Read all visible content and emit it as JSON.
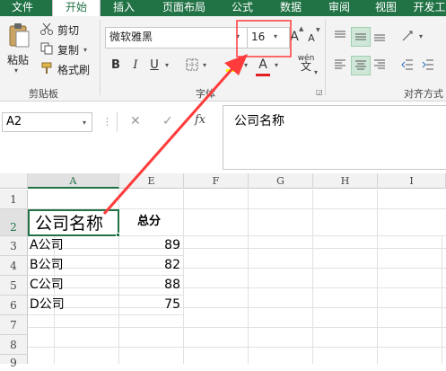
{
  "tabs": [
    "文件",
    "开始",
    "插入",
    "页面布局",
    "公式",
    "数据",
    "审阅",
    "视图",
    "开发工"
  ],
  "clipboard": {
    "paste": "粘贴",
    "cut": "剪切",
    "copy": "复制",
    "format_painter": "格式刷",
    "group": "剪贴板"
  },
  "font": {
    "name": "微软雅黑",
    "size": "16",
    "bold": "B",
    "italic": "I",
    "underline": "U",
    "grow": "A",
    "shrink": "A",
    "color": "A",
    "wen": "wén",
    "group": "字体"
  },
  "align": {
    "group": "对齐方式"
  },
  "namebox": {
    "value": "A2"
  },
  "formula": {
    "fx": "fx",
    "value": "公司名称"
  },
  "columns": [
    "A",
    "E",
    "F",
    "G",
    "H",
    "I"
  ],
  "rows": [
    "1",
    "2",
    "3",
    "4",
    "5",
    "6",
    "7",
    "8",
    "9"
  ],
  "sheet": {
    "header": {
      "a": "公司名称",
      "e": "总分"
    },
    "data": [
      {
        "a": "A公司",
        "e": "89"
      },
      {
        "a": "B公司",
        "e": "82"
      },
      {
        "a": "C公司",
        "e": "88"
      },
      {
        "a": "D公司",
        "e": "75"
      }
    ]
  },
  "accent": "#217346",
  "annotation_color": "#ff3b3b"
}
